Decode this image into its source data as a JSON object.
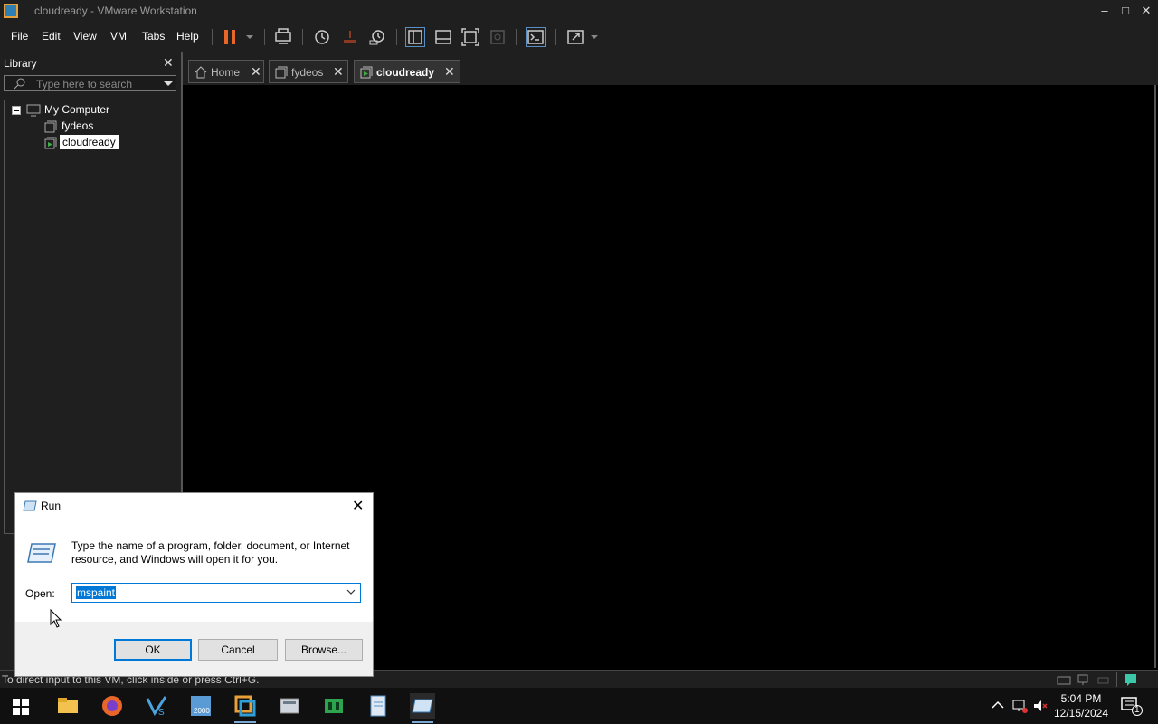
{
  "window": {
    "title": "cloudready  - VMware Workstation"
  },
  "menu": {
    "file": "File",
    "edit": "Edit",
    "view": "View",
    "vm": "VM",
    "tabs": "Tabs",
    "help": "Help"
  },
  "library": {
    "title": "Library",
    "search_placeholder": "Type here to search",
    "tree": {
      "root": "My Computer",
      "items": [
        "fydeos",
        "cloudready"
      ]
    }
  },
  "tabs": [
    {
      "label": "Home"
    },
    {
      "label": "fydeos"
    },
    {
      "label": "cloudready"
    }
  ],
  "status": {
    "message": "To direct input to this VM, click inside or press Ctrl+G."
  },
  "run_dialog": {
    "title": "Run",
    "description": "Type the name of a program, folder, document, or Internet resource, and Windows will open it for you.",
    "open_label": "Open:",
    "open_value": "mspaint",
    "ok": "OK",
    "cancel": "Cancel",
    "browse": "Browse..."
  },
  "taskbar": {
    "time": "5:04 PM",
    "date": "12/15/2024",
    "notification_count": "1"
  },
  "icons": [
    "windows-start-icon",
    "file-explorer-icon",
    "firefox-icon",
    "visual-studio-icon",
    "snipping-icon",
    "vmware-icon",
    "app-icon",
    "green-app-icon",
    "notepad-icon",
    "run-icon"
  ],
  "colors": {
    "accent": "#0078d7",
    "vmware_orange": "#e8a13a",
    "pause_orange": "#e8662a"
  }
}
